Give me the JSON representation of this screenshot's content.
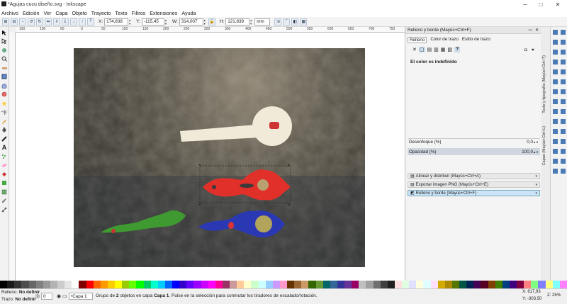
{
  "window": {
    "title": "*Agujas cucu diseño.svg - Inkscape",
    "min": "─",
    "max": "□",
    "close": "✕"
  },
  "menu": [
    "Archivo",
    "Edición",
    "Ver",
    "Capa",
    "Objeto",
    "Trayecto",
    "Texto",
    "Filtros",
    "Extensiones",
    "Ayuda"
  ],
  "toolbar": {
    "x_label": "X:",
    "x_value": "174,838",
    "y_label": "Y:",
    "y_value": "-115,45",
    "w_label": "W:",
    "w_value": "314,007",
    "h_label": "H:",
    "h_value": "121,839",
    "unit": "mm"
  },
  "ruler": {
    "h": [
      "150",
      "100",
      "50",
      "0",
      "50",
      "100",
      "150",
      "200",
      "250",
      "300",
      "350",
      "400",
      "450",
      "500",
      "550",
      "600",
      "650",
      "700",
      "750"
    ]
  },
  "fill_panel": {
    "header": "Relleno y borde (Mayús+Ctrl+F)",
    "tabs": [
      "Relleno",
      "Color de trazo",
      "Estilo de trazo"
    ],
    "fill_type_glyphs": [
      "✕",
      "▢",
      "▤",
      "▥",
      "▦",
      "▧",
      "?"
    ],
    "status": "El color es indefinido",
    "blur_label": "Desenfoque (%)",
    "blur_value": "0,0",
    "opacity_label": "Opacidad (%)",
    "opacity_value": "100,0"
  },
  "collapsed_panels": [
    "Alinear y distribuir (Mayús+Ctrl+A)",
    "Exportar imagen PNG (Mayús+Ctrl+E)",
    "Relleno y borde (Mayús+Ctrl+F)"
  ],
  "vertical_tabs": [
    "Capas (Mayús+Ctrl+L)",
    "Texto y tipografía (Mayús+Ctrl+T)"
  ],
  "status": {
    "fill_label": "Relleno:",
    "fill_value": "No definir",
    "stroke_label": "Trazo:",
    "stroke_value": "No definir",
    "opacity_value": "0",
    "layer": "•Capa 1",
    "message_pre": "Grupo de",
    "message_count": "2",
    "message_mid": "objetos en capa",
    "message_layer": "Capa 1",
    "message_post": ". Pulse en la selección para conmutar los tiradores de escalado/rotación.",
    "x_label": "X:",
    "x_value": "617,93",
    "y_label": "Y:",
    "y_value": "-303,50",
    "zoom_label": "Z:",
    "zoom_value": "25%"
  },
  "palette": [
    "#000000",
    "#1a1a1a",
    "#333333",
    "#4d4d4d",
    "#666666",
    "#808080",
    "#999999",
    "#b3b3b3",
    "#cccccc",
    "#e6e6e6",
    "#ffffff",
    "#800000",
    "#ff0000",
    "#ff6600",
    "#ff9900",
    "#ffcc00",
    "#ffff00",
    "#99cc00",
    "#66ff00",
    "#00ff00",
    "#00cc66",
    "#00ffcc",
    "#00ccff",
    "#0066ff",
    "#0000ff",
    "#3300cc",
    "#6600ff",
    "#9900ff",
    "#cc00ff",
    "#ff00ff",
    "#ff0099",
    "#993366",
    "#cc9999",
    "#ffcc99",
    "#ffffcc",
    "#ccffcc",
    "#ccffff",
    "#99ccff",
    "#cc99ff",
    "#ff99cc",
    "#663300",
    "#996633",
    "#cc9966",
    "#336600",
    "#669933",
    "#006666",
    "#336699",
    "#333399",
    "#663399",
    "#990066",
    "#c0c0c0",
    "#a0a0a0",
    "#707070",
    "#404040",
    "#202020",
    "#ffe0e0",
    "#e0ffe0",
    "#e0e0ff",
    "#ffffe0",
    "#e0ffff",
    "#ffe0ff",
    "#d4aa00",
    "#aa8800",
    "#557700",
    "#005544",
    "#002255",
    "#440055",
    "#550022",
    "#804000",
    "#408000",
    "#004080",
    "#400080",
    "#800040",
    "#ff8080",
    "#80ff80",
    "#8080ff",
    "#ffff80",
    "#80ffff",
    "#ff80ff"
  ]
}
